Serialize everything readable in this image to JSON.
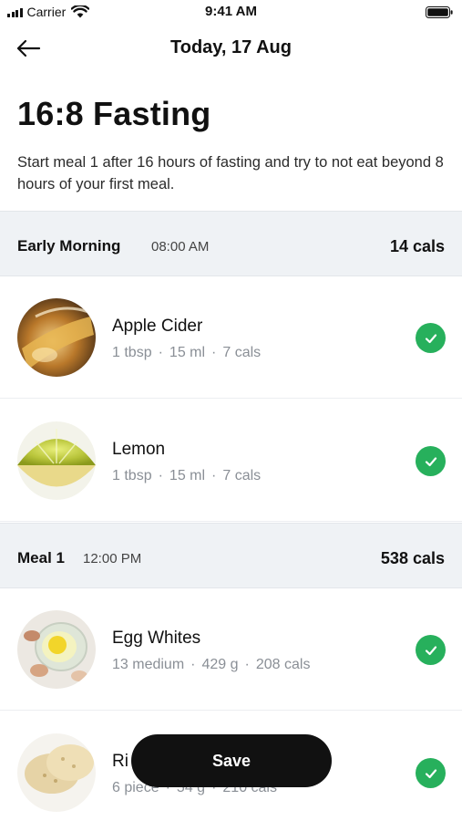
{
  "status_bar": {
    "carrier": "Carrier",
    "time": "9:41 AM",
    "icons": [
      "signal-icon",
      "wifi-icon",
      "battery-icon"
    ]
  },
  "nav": {
    "back_icon": "arrow-left-icon",
    "title": "Today, 17 Aug"
  },
  "plan": {
    "title": "16:8 Fasting",
    "description": "Start meal 1 after 16 hours of fasting and try to not eat beyond 8 hours of your first meal."
  },
  "sections": [
    {
      "name": "Early Morning",
      "time": "08:00 AM",
      "cals": "14 cals",
      "items": [
        {
          "name": "Apple Cider",
          "qty": "1 tbsp",
          "amount": "15 ml",
          "cals": "7 cals",
          "checked": true,
          "image": "apple-cider-photo"
        },
        {
          "name": "Lemon",
          "qty": "1 tbsp",
          "amount": "15 ml",
          "cals": "7 cals",
          "checked": true,
          "image": "lemon-photo"
        }
      ]
    },
    {
      "name": "Meal 1",
      "time": "12:00 PM",
      "cals": "538 cals",
      "items": [
        {
          "name": "Egg Whites",
          "qty": "13 medium",
          "amount": "429 g",
          "cals": "208 cals",
          "checked": true,
          "image": "egg-whites-photo"
        },
        {
          "name": "Ri",
          "qty": "6 piece",
          "amount": "54 g",
          "cals": "210 cals",
          "checked": true,
          "image": "rice-cakes-photo"
        }
      ]
    }
  ],
  "save_button": {
    "label": "Save"
  },
  "colors": {
    "accent_check": "#27b05c",
    "section_bg": "#eff2f5",
    "button_bg": "#111111",
    "meta_text": "#8a8f96"
  }
}
